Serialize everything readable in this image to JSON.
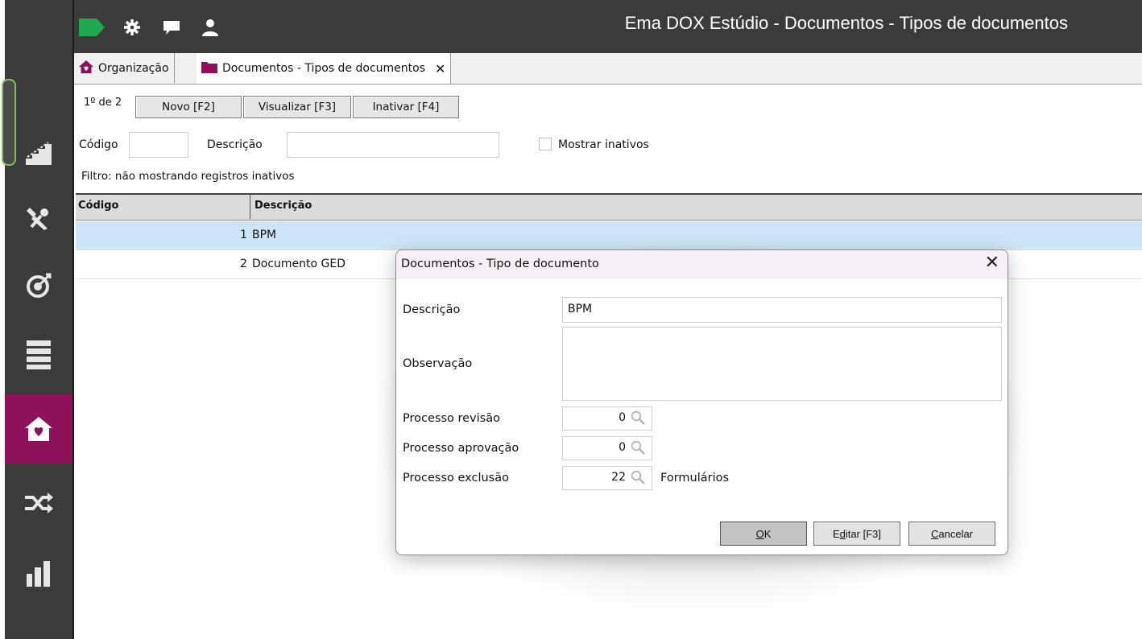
{
  "window": {
    "title": "Ema DOX Estúdio - Documentos - Tipos de documentos"
  },
  "topbar": {
    "icons": [
      "green-flag-icon",
      "gear-icon",
      "chat-icon",
      "user-icon"
    ],
    "accent_green": "#1faa50"
  },
  "sidebar": {
    "items": [
      {
        "icon": "stairs-icon"
      },
      {
        "icon": "tools-icon"
      },
      {
        "icon": "target-icon"
      },
      {
        "icon": "list-icon"
      },
      {
        "icon": "home-heart-icon",
        "active": true
      },
      {
        "icon": "shuffle-icon"
      },
      {
        "icon": "bar-chart-icon"
      }
    ],
    "active_color": "#8e1159"
  },
  "tabs": [
    {
      "label": "Organização",
      "icon": "home-icon"
    },
    {
      "label": "Documentos - Tipos de documentos",
      "icon": "folder-icon",
      "close": "✕"
    }
  ],
  "toolbar": {
    "record": "1º de 2",
    "new_label": "Novo [F2]",
    "view_label": "Visualizar [F3]",
    "inactivate_label": "Inativar [F4]"
  },
  "filters": {
    "code_label": "Código",
    "code_value": "",
    "desc_label": "Descrição",
    "desc_value": "",
    "show_inactive_label": "Mostrar inativos",
    "show_inactive_checked": false,
    "filter_text": "Filtro: não mostrando registros inativos"
  },
  "grid": {
    "columns": [
      "Código",
      "Descrição"
    ],
    "rows": [
      {
        "code": "1",
        "desc": "BPM",
        "selected": true
      },
      {
        "code": "2",
        "desc": "Documento GED",
        "selected": false
      }
    ]
  },
  "dialog": {
    "title": "Documentos - Tipo de documento",
    "close": "✕",
    "descricao_label": "Descrição",
    "descricao_value": "BPM",
    "observacao_label": "Observação",
    "observacao_value": "",
    "revisao_label": "Processo revisão",
    "revisao_value": "0",
    "aprovacao_label": "Processo aprovação",
    "aprovacao_value": "0",
    "exclusao_label": "Processo exclusão",
    "exclusao_value": "22",
    "formularios_label": "Formulários",
    "ok_mnemonic": "O",
    "ok_rest": "K",
    "edit_pre": "E",
    "edit_mnemonic": "d",
    "edit_rest": "itar [F3]",
    "cancel_mnemonic": "C",
    "cancel_rest": "ancelar"
  }
}
